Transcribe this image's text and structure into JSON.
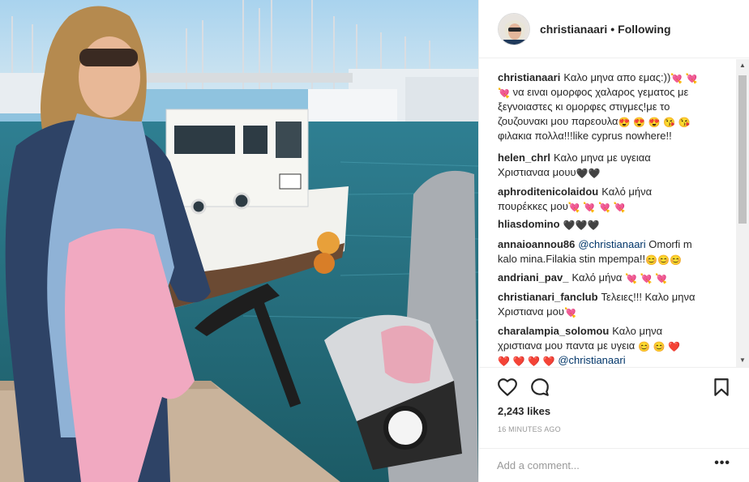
{
  "header": {
    "username": "christianaari",
    "separator": "•",
    "follow_status": "Following"
  },
  "comments": [
    {
      "username": "christianaari",
      "lines": [
        "Καλο μηνα απο εμας:))",
        "να ειναι ομορφος χαλαρος γεματος με",
        "ξεγνοιαστες κι ομορφες στιγμες!με το",
        "ζουζουνακι μου παρεουλα",
        "φιλακια πολλα!!!like cyprus nowhere!!"
      ],
      "emojis": [
        "💘",
        "💘",
        "💘",
        "😍",
        "😍",
        "😍",
        "😘",
        "😘"
      ]
    },
    {
      "username": "helen_chrl",
      "lines": [
        "Καλο μηνα με υγειαα",
        "Χριστιαναα μουυ"
      ],
      "emojis": [
        "🖤",
        "🖤"
      ]
    },
    {
      "username": "aphroditenicolaidou",
      "lines": [
        "Καλό μήνα",
        "πουρέκκες μου"
      ],
      "emojis": [
        "💘",
        "💘",
        "💘",
        "💘"
      ]
    },
    {
      "username": "hliasdomino",
      "lines": [
        ""
      ],
      "emojis": [
        "🖤",
        "🖤",
        "🖤"
      ]
    },
    {
      "username": "annaioannou86",
      "mention": "@christianaari",
      "lines": [
        "Omorfi m",
        "kalo mina.Filakia stin mpempa!!"
      ],
      "emojis": [
        "😊",
        "😊",
        "😊"
      ]
    },
    {
      "username": "andriani_pav_",
      "lines": [
        "Καλό μήνα"
      ],
      "emojis": [
        "💘",
        "💘",
        "💘"
      ]
    },
    {
      "username": "christianari_fanclub",
      "lines": [
        "Τελειες!!! Καλο μηνα",
        "Χριστιανα μου"
      ],
      "emojis": [
        "💘"
      ]
    },
    {
      "username": "charalampia_solomou",
      "lines": [
        "Καλο μηνα",
        "χριστιανα μου παντα με υγεια"
      ],
      "emojis": [
        "😊",
        "😊",
        "❤️",
        "❤️",
        "❤️",
        "❤️",
        "❤️"
      ],
      "mention": "@christianaari"
    }
  ],
  "actions": {
    "like_icon": "heart-icon",
    "comment_icon": "comment-bubble-icon",
    "save_icon": "bookmark-icon"
  },
  "likes": "2,243 likes",
  "time": "16 MINUTES AGO",
  "add_comment": {
    "placeholder": "Add a comment...",
    "more_label": "•••"
  },
  "colors": {
    "text": "#262626",
    "muted": "#999999",
    "mention": "#003569",
    "border": "#efefef",
    "heart_emoji": "#e0245e"
  }
}
